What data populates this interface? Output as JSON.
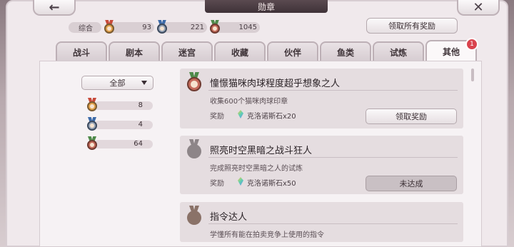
{
  "header": {
    "title": "勋章",
    "back_icon": "←",
    "close_icon": "✕"
  },
  "stats": {
    "label": "综合",
    "gold": "93",
    "silver": "221",
    "bronze": "1045"
  },
  "claim_all_label": "领取所有奖励",
  "tabs": [
    "战斗",
    "剧本",
    "迷宫",
    "收藏",
    "伙伴",
    "鱼类",
    "试炼",
    "其他"
  ],
  "active_tab": "其他",
  "badge_count": "1",
  "filter": {
    "selected": "全部"
  },
  "counts": {
    "gold": "8",
    "silver": "4",
    "bronze": "64"
  },
  "achievements": [
    {
      "title": "憧憬猫咪肉球程度超乎想象之人",
      "desc": "收集600个猫咪肉球印章",
      "reward_label": "奖励",
      "reward": "克洛诺斯石x20",
      "button": "领取奖励",
      "state": "claim"
    },
    {
      "title": "照亮时空黑暗之战斗狂人",
      "desc": "完成照亮时空黑暗之人的试炼",
      "reward_label": "奖励",
      "reward": "克洛诺斯石x50",
      "button": "未达成",
      "state": "locked"
    },
    {
      "title": "指令达人",
      "desc": "学懂所有能在拍卖竞争上使用的指令",
      "reward_label": "",
      "reward": "",
      "button": "",
      "state": "locked"
    }
  ],
  "colors": {
    "accent": "#d9434d",
    "panel": "#f6f2f4",
    "card": "#e5dde0"
  }
}
